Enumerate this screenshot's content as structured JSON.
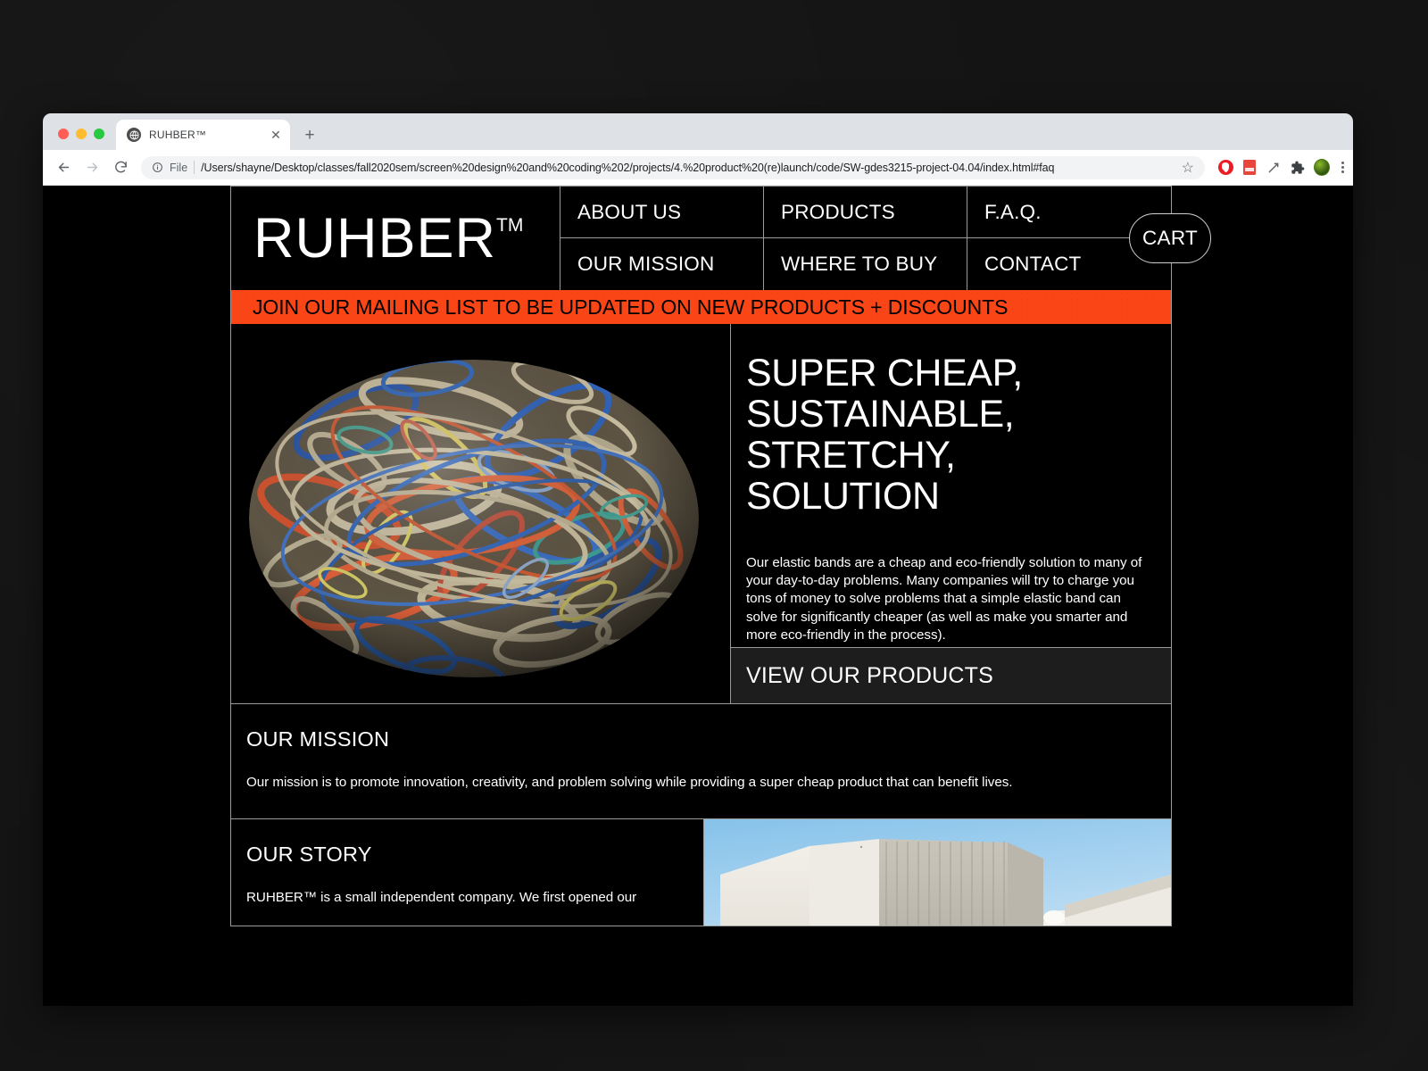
{
  "browser": {
    "tab_title": "RUHBER™",
    "tab_favicon": "globe-icon",
    "new_tab_label": "+",
    "close_label": "✕",
    "back_label": "←",
    "forward_label": "→",
    "reload_label": "⟳",
    "scheme_label": "File",
    "url": "/Users/shayne/Desktop/classes/fall2020sem/screen%20design%20and%20coding%202/projects/4.%20product%20(re)launch/code/SW-gdes3215-project-04.04/index.html#faq",
    "star_label": "☆",
    "extensions": [
      "shield-icon",
      "document-icon",
      "lightning-icon",
      "puzzle-icon",
      "profile-avatar"
    ]
  },
  "site": {
    "logo": "RUHBER",
    "logo_tm": "TM",
    "nav": [
      {
        "label": "ABOUT US"
      },
      {
        "label": "PRODUCTS"
      },
      {
        "label": "F.A.Q."
      },
      {
        "label": "OUR MISSION"
      },
      {
        "label": "WHERE TO BUY"
      },
      {
        "label": "CONTACT"
      }
    ],
    "cart_label": "CART",
    "banner": "JOIN OUR MAILING LIST TO BE UPDATED ON NEW PRODUCTS + DISCOUNTS",
    "hero": {
      "image_alt": "rubber-band-ball-photo",
      "title": "SUPER CHEAP,\nSUSTAINABLE,\nSTRETCHY,\nSOLUTION",
      "paragraph": "Our elastic bands are a cheap and eco-friendly solution to many of your day-to-day problems. Many companies will try to charge you tons of money to solve problems that a simple elastic band can solve for significantly cheaper (as well as make you smarter and more eco-friendly in the process).",
      "cta_label": "VIEW OUR PRODUCTS"
    },
    "mission": {
      "heading": "OUR MISSION",
      "body": "Our mission is to promote innovation, creativity, and problem solving while providing a super cheap product that can benefit lives."
    },
    "story": {
      "heading": "OUR STORY",
      "body": "RUHBER™ is a small independent company. We first opened our",
      "image_alt": "warehouse-factory-photo"
    }
  },
  "colors": {
    "accent_orange": "#fa4616",
    "page_background": "#000000",
    "border": "#9a9a9a",
    "text": "#ffffff",
    "cta_background": "#1d1d1d"
  }
}
